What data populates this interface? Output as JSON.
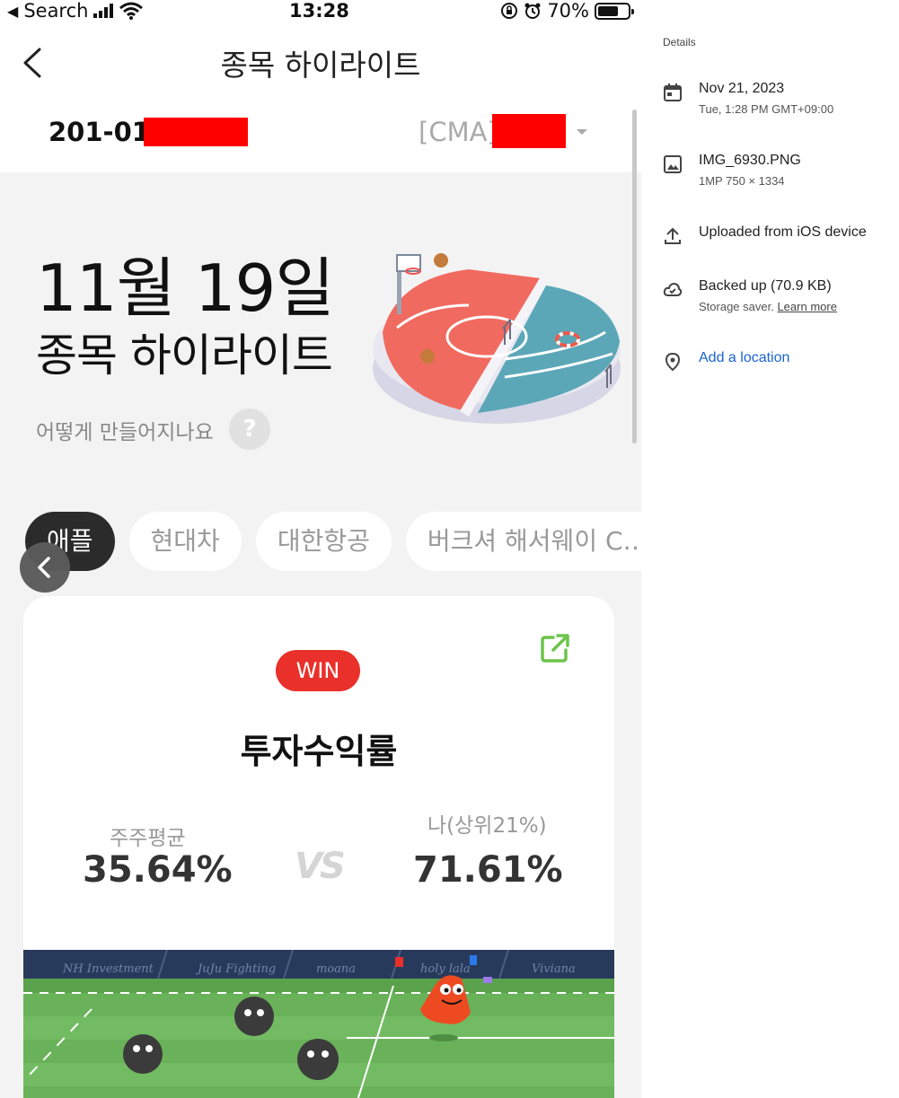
{
  "status_bar": {
    "back_app_label": "Search",
    "time": "13:28",
    "battery_percent": "70%",
    "battery_level": 0.7
  },
  "nav": {
    "title": "종목 하이라이트"
  },
  "account": {
    "number_prefix": "201-01-",
    "type_prefix": "[CMA]"
  },
  "hero": {
    "date": "11월 19일",
    "title": "종목 하이라이트",
    "help_text": "어떻게 만들어지나요",
    "help_icon": "?"
  },
  "chips": [
    {
      "label": "애플",
      "active": true
    },
    {
      "label": "현대차",
      "active": false
    },
    {
      "label": "대한항공",
      "active": false
    },
    {
      "label": "버크셔 해서웨이 C…",
      "active": false
    }
  ],
  "card": {
    "badge": "WIN",
    "title": "투자수익률",
    "avg_label": "주주평균",
    "avg_value": "35.64%",
    "vs_text": "VS",
    "me_label": "나(상위21%)",
    "me_value": "71.61%",
    "field_banners": [
      "NH Investment",
      "JuJu Fighting",
      "moana",
      "holy lala",
      "Viviana"
    ]
  },
  "details_panel": {
    "heading": "Details",
    "date": {
      "main": "Nov 21, 2023",
      "sub": "Tue, 1:28 PM   GMT+09:00",
      "icon": "calendar-icon"
    },
    "file": {
      "main": "IMG_6930.PNG",
      "sub": "1MP    750 × 1334",
      "icon": "image-icon"
    },
    "upload": {
      "main": "Uploaded from iOS device",
      "icon": "upload-icon"
    },
    "backup": {
      "main": "Backed up (70.9 KB)",
      "sub_prefix": "Storage saver. ",
      "sub_link": "Learn more",
      "icon": "cloud-done-icon"
    },
    "location": {
      "main": "Add a location",
      "icon": "location-pin-icon"
    }
  },
  "colors": {
    "win_badge": "#e9302a",
    "redaction": "#ff0000",
    "link_blue": "#1a63d6",
    "chip_active": "#2b2b2b"
  }
}
